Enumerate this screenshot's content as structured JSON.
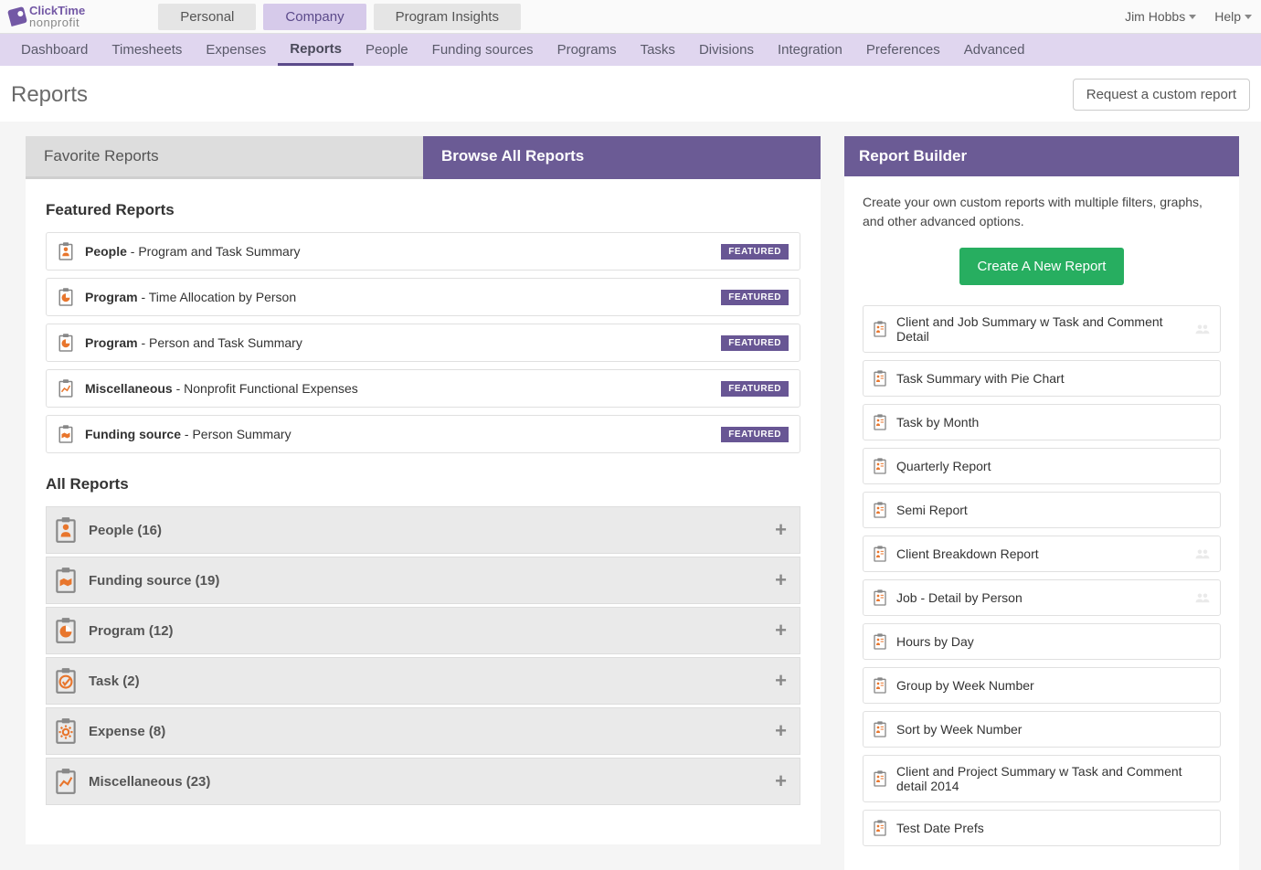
{
  "logo": {
    "line1": "ClickTime",
    "line2": "nonprofit"
  },
  "mode_tabs": [
    {
      "label": "Personal",
      "active": false
    },
    {
      "label": "Company",
      "active": true
    },
    {
      "label": "Program Insights",
      "active": false
    }
  ],
  "user_menu": {
    "name": "Jim Hobbs",
    "help": "Help"
  },
  "nav": [
    {
      "label": "Dashboard"
    },
    {
      "label": "Timesheets"
    },
    {
      "label": "Expenses"
    },
    {
      "label": "Reports",
      "active": true
    },
    {
      "label": "People"
    },
    {
      "label": "Funding sources"
    },
    {
      "label": "Programs"
    },
    {
      "label": "Tasks"
    },
    {
      "label": "Divisions"
    },
    {
      "label": "Integration"
    },
    {
      "label": "Preferences"
    },
    {
      "label": "Advanced"
    }
  ],
  "page": {
    "title": "Reports",
    "request_button": "Request a custom report"
  },
  "report_tabs": {
    "favorites": "Favorite Reports",
    "browse": "Browse All Reports"
  },
  "featured": {
    "title": "Featured Reports",
    "badge": "FEATURED",
    "items": [
      {
        "category": "People",
        "name": " - Program and Task Summary",
        "icon": "person"
      },
      {
        "category": "Program",
        "name": " - Time Allocation by Person",
        "icon": "pie"
      },
      {
        "category": "Program",
        "name": " - Person and Task Summary",
        "icon": "pie"
      },
      {
        "category": "Miscellaneous",
        "name": " - Nonprofit Functional Expenses",
        "icon": "chart"
      },
      {
        "category": "Funding source",
        "name": " - Person Summary",
        "icon": "handshake"
      }
    ]
  },
  "all_reports": {
    "title": "All Reports",
    "groups": [
      {
        "label": "People (16)",
        "icon": "person"
      },
      {
        "label": "Funding source (19)",
        "icon": "handshake"
      },
      {
        "label": "Program (12)",
        "icon": "pie"
      },
      {
        "label": "Task (2)",
        "icon": "check"
      },
      {
        "label": "Expense (8)",
        "icon": "gear"
      },
      {
        "label": "Miscellaneous (23)",
        "icon": "chart"
      }
    ]
  },
  "report_builder": {
    "title": "Report Builder",
    "description": "Create your own custom reports with multiple filters, graphs, and other advanced options.",
    "create_button": "Create A New Report",
    "items": [
      {
        "label": "Client and Job Summary w Task and Comment Detail",
        "shared": true
      },
      {
        "label": "Task Summary with Pie Chart",
        "shared": false
      },
      {
        "label": "Task by Month",
        "shared": false
      },
      {
        "label": "Quarterly Report",
        "shared": false
      },
      {
        "label": "Semi Report",
        "shared": false
      },
      {
        "label": "Client Breakdown Report",
        "shared": true
      },
      {
        "label": "Job - Detail by Person",
        "shared": true
      },
      {
        "label": "Hours by Day",
        "shared": false
      },
      {
        "label": "Group by Week Number",
        "shared": false
      },
      {
        "label": "Sort by Week Number",
        "shared": false
      },
      {
        "label": "Client and Project Summary w Task and Comment detail 2014",
        "shared": false
      },
      {
        "label": "Test Date Prefs",
        "shared": false
      }
    ]
  }
}
